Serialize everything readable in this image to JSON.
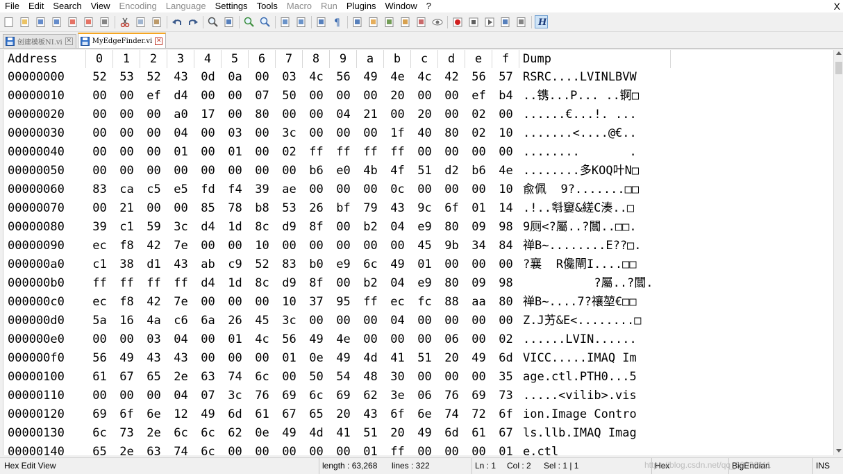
{
  "menu": {
    "items": [
      {
        "label": "File",
        "enabled": true
      },
      {
        "label": "Edit",
        "enabled": true
      },
      {
        "label": "Search",
        "enabled": true
      },
      {
        "label": "View",
        "enabled": true
      },
      {
        "label": "Encoding",
        "enabled": false
      },
      {
        "label": "Language",
        "enabled": false
      },
      {
        "label": "Settings",
        "enabled": true
      },
      {
        "label": "Tools",
        "enabled": true
      },
      {
        "label": "Macro",
        "enabled": false
      },
      {
        "label": "Run",
        "enabled": false
      },
      {
        "label": "Plugins",
        "enabled": true
      },
      {
        "label": "Window",
        "enabled": true
      },
      {
        "label": "?",
        "enabled": true
      }
    ],
    "close_label": "X"
  },
  "toolbar": {
    "icons": [
      "new-file-icon",
      "open-file-icon",
      "save-icon",
      "save-all-icon",
      "close-icon",
      "close-all-icon",
      "print-icon",
      "|",
      "cut-icon",
      "copy-icon",
      "paste-icon",
      "|",
      "undo-icon",
      "redo-icon",
      "|",
      "find-icon",
      "replace-icon",
      "|",
      "zoom-in-icon",
      "zoom-out-icon",
      "|",
      "sync-vertical-icon",
      "sync-horizontal-icon",
      "|",
      "word-wrap-icon",
      "show-all-chars-icon",
      "|",
      "indent-guide-icon",
      "document-map-icon",
      "function-list-icon",
      "folder-workspace-icon",
      "monitoring-icon",
      "eye-icon",
      "|",
      "record-macro-icon",
      "stop-macro-icon",
      "play-macro-icon",
      "run-macro-multiple-icon",
      "save-macro-icon",
      "|",
      "hex-editor-icon"
    ]
  },
  "tabs": [
    {
      "label": "创建模板NI.vi",
      "active": false
    },
    {
      "label": "MyEdgeFinder.vi",
      "active": true
    }
  ],
  "hex": {
    "header": {
      "address": "Address",
      "columns": [
        "0",
        "1",
        "2",
        "3",
        "4",
        "5",
        "6",
        "7",
        "8",
        "9",
        "a",
        "b",
        "c",
        "d",
        "e",
        "f"
      ],
      "dump": "Dump"
    },
    "rows": [
      {
        "address": "00000000",
        "bytes": [
          "52",
          "53",
          "52",
          "43",
          "0d",
          "0a",
          "00",
          "03",
          "4c",
          "56",
          "49",
          "4e",
          "4c",
          "42",
          "56",
          "57"
        ],
        "dump": "RSRC....LVINLBVW"
      },
      {
        "address": "00000010",
        "bytes": [
          "00",
          "00",
          "ef",
          "d4",
          "00",
          "00",
          "07",
          "50",
          "00",
          "00",
          "00",
          "20",
          "00",
          "00",
          "ef",
          "b4"
        ],
        "dump": "..镌...P... ..锕□"
      },
      {
        "address": "00000020",
        "bytes": [
          "00",
          "00",
          "00",
          "a0",
          "17",
          "00",
          "80",
          "00",
          "00",
          "04",
          "21",
          "00",
          "20",
          "00",
          "02",
          "00"
        ],
        "dump": "......€...!. ..."
      },
      {
        "address": "00000030",
        "bytes": [
          "00",
          "00",
          "00",
          "04",
          "00",
          "03",
          "00",
          "3c",
          "00",
          "00",
          "00",
          "1f",
          "40",
          "80",
          "02",
          "10"
        ],
        "dump": ".......<....@€.."
      },
      {
        "address": "00000040",
        "bytes": [
          "00",
          "00",
          "00",
          "01",
          "00",
          "01",
          "00",
          "02",
          "ff",
          "ff",
          "ff",
          "ff",
          "00",
          "00",
          "00",
          "00"
        ],
        "dump": "........       ."
      },
      {
        "address": "00000050",
        "bytes": [
          "00",
          "00",
          "00",
          "00",
          "00",
          "00",
          "00",
          "00",
          "b6",
          "e0",
          "4b",
          "4f",
          "51",
          "d2",
          "b6",
          "4e"
        ],
        "dump": "........多KOQ叶N□"
      },
      {
        "address": "00000060",
        "bytes": [
          "83",
          "ca",
          "c5",
          "e5",
          "fd",
          "f4",
          "39",
          "ae",
          "00",
          "00",
          "00",
          "0c",
          "00",
          "00",
          "00",
          "10"
        ],
        "dump": "兪佩  9?.......□□"
      },
      {
        "address": "00000070",
        "bytes": [
          "00",
          "21",
          "00",
          "00",
          "85",
          "78",
          "b8",
          "53",
          "26",
          "bf",
          "79",
          "43",
          "9c",
          "6f",
          "01",
          "14"
        ],
        "dump": ".!..厁窶&縒C湊..□"
      },
      {
        "address": "00000080",
        "bytes": [
          "39",
          "c1",
          "59",
          "3c",
          "d4",
          "1d",
          "8c",
          "d9",
          "8f",
          "00",
          "b2",
          "04",
          "e9",
          "80",
          "09",
          "98"
        ],
        "dump": "9厕<?屬..?闒..□□."
      },
      {
        "address": "00000090",
        "bytes": [
          "ec",
          "f8",
          "42",
          "7e",
          "00",
          "00",
          "10",
          "00",
          "00",
          "00",
          "00",
          "00",
          "45",
          "9b",
          "34",
          "84"
        ],
        "dump": "禅B~........E??□."
      },
      {
        "address": "000000a0",
        "bytes": [
          "c1",
          "38",
          "d1",
          "43",
          "ab",
          "c9",
          "52",
          "83",
          "b0",
          "e9",
          "6c",
          "49",
          "01",
          "00",
          "00",
          "00"
        ],
        "dump": "?襄  R儳閘I....□□"
      },
      {
        "address": "000000b0",
        "bytes": [
          "ff",
          "ff",
          "ff",
          "ff",
          "d4",
          "1d",
          "8c",
          "d9",
          "8f",
          "00",
          "b2",
          "04",
          "e9",
          "80",
          "09",
          "98"
        ],
        "dump": "          ?屬..?闒."
      },
      {
        "address": "000000c0",
        "bytes": [
          "ec",
          "f8",
          "42",
          "7e",
          "00",
          "00",
          "00",
          "10",
          "37",
          "95",
          "ff",
          "ec",
          "fc",
          "88",
          "aa",
          "80"
        ],
        "dump": "禅B~....7?禳堃€□□"
      },
      {
        "address": "000000d0",
        "bytes": [
          "5a",
          "16",
          "4a",
          "c6",
          "6a",
          "26",
          "45",
          "3c",
          "00",
          "00",
          "00",
          "04",
          "00",
          "00",
          "00",
          "00"
        ],
        "dump": "Z.J艻&E<........□"
      },
      {
        "address": "000000e0",
        "bytes": [
          "00",
          "00",
          "03",
          "04",
          "00",
          "01",
          "4c",
          "56",
          "49",
          "4e",
          "00",
          "00",
          "00",
          "06",
          "00",
          "02"
        ],
        "dump": "......LVIN......"
      },
      {
        "address": "000000f0",
        "bytes": [
          "56",
          "49",
          "43",
          "43",
          "00",
          "00",
          "00",
          "01",
          "0e",
          "49",
          "4d",
          "41",
          "51",
          "20",
          "49",
          "6d"
        ],
        "dump": "VICC.....IMAQ Im"
      },
      {
        "address": "00000100",
        "bytes": [
          "61",
          "67",
          "65",
          "2e",
          "63",
          "74",
          "6c",
          "00",
          "50",
          "54",
          "48",
          "30",
          "00",
          "00",
          "00",
          "35"
        ],
        "dump": "age.ctl.PTH0...5"
      },
      {
        "address": "00000110",
        "bytes": [
          "00",
          "00",
          "00",
          "04",
          "07",
          "3c",
          "76",
          "69",
          "6c",
          "69",
          "62",
          "3e",
          "06",
          "76",
          "69",
          "73"
        ],
        "dump": ".....<vilib>.vis"
      },
      {
        "address": "00000120",
        "bytes": [
          "69",
          "6f",
          "6e",
          "12",
          "49",
          "6d",
          "61",
          "67",
          "65",
          "20",
          "43",
          "6f",
          "6e",
          "74",
          "72",
          "6f"
        ],
        "dump": "ion.Image Contro"
      },
      {
        "address": "00000130",
        "bytes": [
          "6c",
          "73",
          "2e",
          "6c",
          "6c",
          "62",
          "0e",
          "49",
          "4d",
          "41",
          "51",
          "20",
          "49",
          "6d",
          "61",
          "67"
        ],
        "dump": "ls.llb.IMAQ Imag"
      },
      {
        "address": "00000140",
        "bytes": [
          "65",
          "2e",
          "63",
          "74",
          "6c",
          "00",
          "00",
          "00",
          "00",
          "00",
          "01",
          "ff",
          "00",
          "00",
          "00",
          "01"
        ],
        "dump": "e.ctl"
      }
    ]
  },
  "status": {
    "mode": "Hex Edit View",
    "length": "length : 63,268",
    "lines": "lines : 322",
    "ln": "Ln : 1",
    "col": "Col : 2",
    "sel": "Sel : 1 | 1",
    "view": "Hex",
    "endian": "BigEndian",
    "ins": "INS",
    "watermark": "https://blog.csdn.net/qq_39930111"
  }
}
